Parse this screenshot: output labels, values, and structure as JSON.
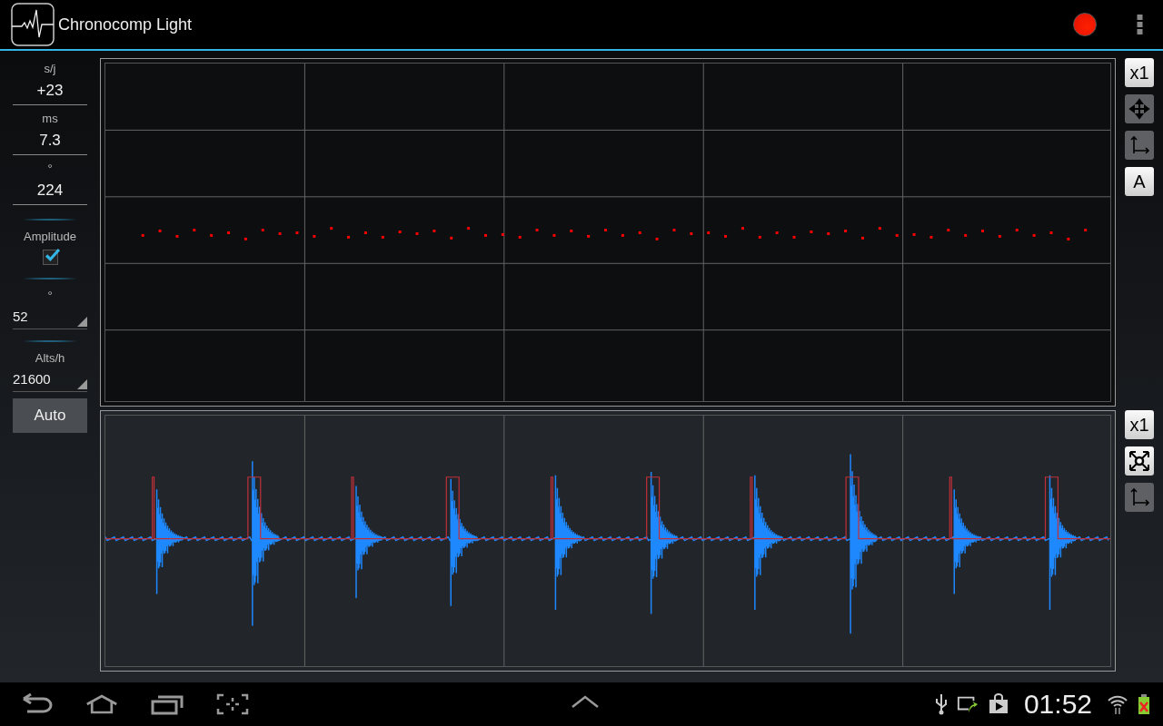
{
  "app_bar": {
    "title": "Chronocomp Light",
    "recording": true
  },
  "sidebar": {
    "fields": [
      {
        "label": "s/j",
        "value": "+23"
      },
      {
        "label": "ms",
        "value": "7.3"
      },
      {
        "label": "°",
        "value": "224"
      }
    ],
    "amplitude": {
      "label": "Amplitude",
      "checked": true
    },
    "spinners": [
      {
        "label": "°",
        "value": "52"
      },
      {
        "label": "Alts/h",
        "value": "21600"
      }
    ],
    "auto_button": "Auto"
  },
  "top_tools": [
    {
      "kind": "text",
      "label": "x1",
      "selected": true
    },
    {
      "kind": "move",
      "selected": false
    },
    {
      "kind": "axes",
      "selected": false
    },
    {
      "kind": "text",
      "label": "A",
      "selected": true
    }
  ],
  "bottom_tools": [
    {
      "kind": "text",
      "label": "x1",
      "selected": true
    },
    {
      "kind": "fit",
      "selected": true
    },
    {
      "kind": "axes",
      "selected": false
    }
  ],
  "status_bar": {
    "time": "01:52"
  }
}
